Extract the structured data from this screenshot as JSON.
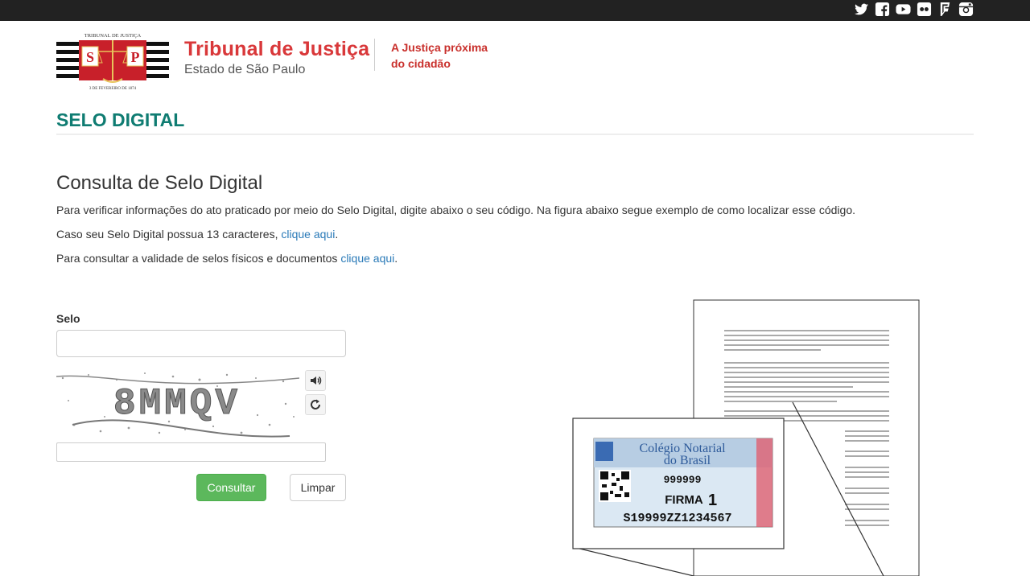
{
  "topbar": {
    "social": [
      "twitter-icon",
      "facebook-icon",
      "youtube-icon",
      "flickr-icon",
      "foursquare-icon",
      "instagram-icon"
    ]
  },
  "logo": {
    "arc_text": "TRIBUNAL DE JUSTIÇA",
    "date_text": "3 DE FEVEREIRO DE 1874",
    "left_letter": "S",
    "right_letter": "P"
  },
  "brand": {
    "title": "Tribunal de Justiça",
    "subtitle": "Estado de São Paulo",
    "slogan_line1": "A Justiça próxima",
    "slogan_line2": "do cidadão"
  },
  "section": {
    "title": "SELO DIGITAL"
  },
  "content": {
    "heading": "Consulta de Selo Digital",
    "p1": "Para verificar informações do ato praticado por meio do Selo Digital, digite abaixo o seu código. Na figura abaixo segue exemplo de como localizar esse código.",
    "p2_prefix": "Caso seu Selo Digital possua 13 caracteres, ",
    "p2_link": "clique aqui",
    "p2_suffix": ".",
    "p3_prefix": "Para consultar a validade de selos físicos e documentos ",
    "p3_link": "clique aqui",
    "p3_suffix": "."
  },
  "form": {
    "selo_label": "Selo",
    "selo_value": "",
    "captcha_text": "8MMQV",
    "captcha_value": "",
    "consultar_label": "Consultar",
    "limpar_label": "Limpar"
  },
  "example": {
    "seal_title_line1": "Colégio Notarial",
    "seal_title_line2": "do Brasil",
    "seal_number": "999999",
    "seal_type": "FIRMA",
    "seal_type_num": "1",
    "seal_code": "S19999ZZ1234567"
  },
  "colors": {
    "accent_red": "#d9383a",
    "section_teal": "#0f7c72",
    "link_blue": "#2a7ab8",
    "button_green": "#5cb85c"
  }
}
